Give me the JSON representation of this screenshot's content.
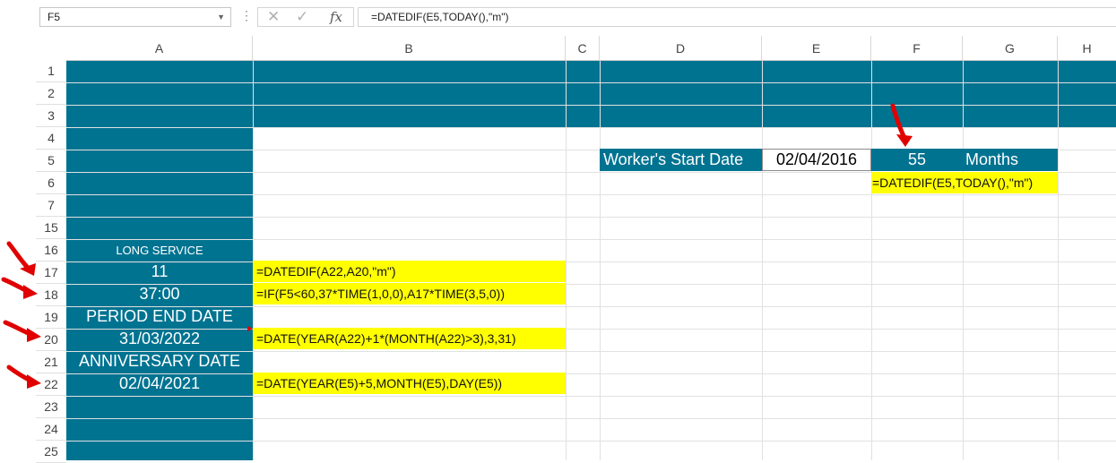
{
  "formula_bar": {
    "name_box": "F5",
    "formula": "=DATEDIF(E5,TODAY(),\"m\")"
  },
  "columns": [
    "A",
    "B",
    "C",
    "D",
    "E",
    "F",
    "G",
    "H"
  ],
  "rows": [
    "1",
    "2",
    "3",
    "4",
    "5",
    "6",
    "7",
    "15",
    "16",
    "17",
    "18",
    "19",
    "20",
    "21",
    "22",
    "23",
    "24",
    "25"
  ],
  "cells": {
    "a16": "LONG SERVICE",
    "a17": "11",
    "a18": "37:00",
    "a19": "PERIOD END DATE",
    "a20": "31/03/2022",
    "a21": "ANNIVERSARY DATE",
    "a22": "02/04/2021",
    "b17": "=DATEDIF(A22,A20,\"m\")",
    "b18": "=IF(F5<60,37*TIME(1,0,0),A17*TIME(3,5,0))",
    "b20": "=DATE(YEAR(A22)+1*(MONTH(A22)>3),3,31)",
    "b22": "=DATE(YEAR(E5)+5,MONTH(E5),DAY(E5))",
    "d5": "Worker's Start Date",
    "e5": "02/04/2016",
    "f5": "55",
    "g5": "Months",
    "f6": "=DATEDIF(E5,TODAY(),\"m\")"
  },
  "colors": {
    "teal": "#007391",
    "highlight": "#ffff00",
    "arrow": "#e00000"
  }
}
